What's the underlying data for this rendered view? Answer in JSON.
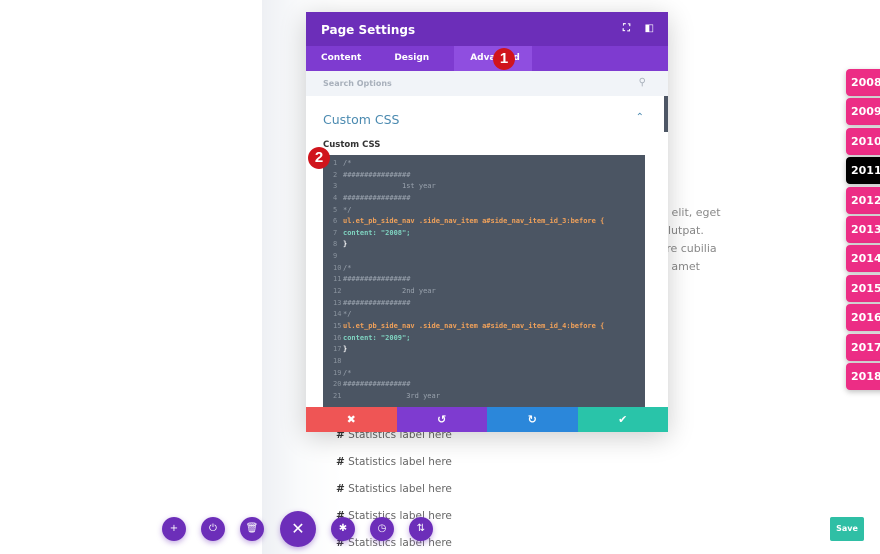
{
  "background": {
    "text_lines": [
      "andit elit, eget",
      "or volutpat.",
      "osuere cubilia",
      "er sit amet"
    ],
    "stat_hash": "#",
    "stat_label": "Statistics label here"
  },
  "modal": {
    "title": "Page Settings",
    "icons": [
      "expand-icon",
      "sidebar-icon"
    ],
    "tabs": [
      {
        "label": "Content"
      },
      {
        "label": "Design"
      },
      {
        "label": "Advanced"
      }
    ],
    "search_placeholder": "Search Options",
    "section_title": "Custom CSS",
    "field_label": "Custom CSS",
    "step1": "1",
    "step2": "2",
    "code": [
      {
        "n": "1",
        "t": "/*",
        "c": "cm"
      },
      {
        "n": "2",
        "t": "################",
        "c": "cm"
      },
      {
        "n": "3",
        "t": "              1st year",
        "c": "cm"
      },
      {
        "n": "4",
        "t": "################",
        "c": "cm"
      },
      {
        "n": "5",
        "t": "*/",
        "c": "cm"
      },
      {
        "n": "6",
        "t": "ul.et_pb_side_nav .side_nav_item a#side_nav_item_id_3:before {",
        "c": "sel"
      },
      {
        "n": "7",
        "t": "content: \"2008\";",
        "c": "prop"
      },
      {
        "n": "8",
        "t": "}",
        "c": "w"
      },
      {
        "n": "9",
        "t": "",
        "c": "cm"
      },
      {
        "n": "10",
        "t": "/*",
        "c": "cm"
      },
      {
        "n": "11",
        "t": "################",
        "c": "cm"
      },
      {
        "n": "12",
        "t": "              2nd year",
        "c": "cm"
      },
      {
        "n": "13",
        "t": "################",
        "c": "cm"
      },
      {
        "n": "14",
        "t": "*/",
        "c": "cm"
      },
      {
        "n": "15",
        "t": "ul.et_pb_side_nav .side_nav_item a#side_nav_item_id_4:before {",
        "c": "sel"
      },
      {
        "n": "16",
        "t": "content: \"2009\";",
        "c": "prop"
      },
      {
        "n": "17",
        "t": "}",
        "c": "w"
      },
      {
        "n": "18",
        "t": "",
        "c": "cm"
      },
      {
        "n": "19",
        "t": "/*",
        "c": "cm"
      },
      {
        "n": "20",
        "t": "################",
        "c": "cm"
      },
      {
        "n": "21",
        "t": "               3rd year",
        "c": "cm"
      }
    ],
    "actions": [
      {
        "name": "cancel",
        "glyph": "✖",
        "color": "#ef5555"
      },
      {
        "name": "undo",
        "glyph": "↺",
        "color": "#7e3bd0"
      },
      {
        "name": "redo",
        "glyph": "↻",
        "color": "#2b87da"
      },
      {
        "name": "save",
        "glyph": "✔",
        "color": "#29c4a9"
      }
    ]
  },
  "toolbar": [
    {
      "name": "add",
      "glyph": "+"
    },
    {
      "name": "power",
      "glyph": "⏻"
    },
    {
      "name": "trash",
      "glyph": "🗑"
    },
    {
      "name": "close",
      "glyph": "✕"
    },
    {
      "name": "settings",
      "glyph": "✱"
    },
    {
      "name": "history",
      "glyph": "◷"
    },
    {
      "name": "sort",
      "glyph": "⇅"
    }
  ],
  "years": [
    "2008",
    "2009",
    "2010",
    "2011",
    "2012",
    "2013",
    "2014",
    "2015",
    "2016",
    "2017",
    "2018"
  ],
  "active_year": "2011",
  "save_label": "Save"
}
